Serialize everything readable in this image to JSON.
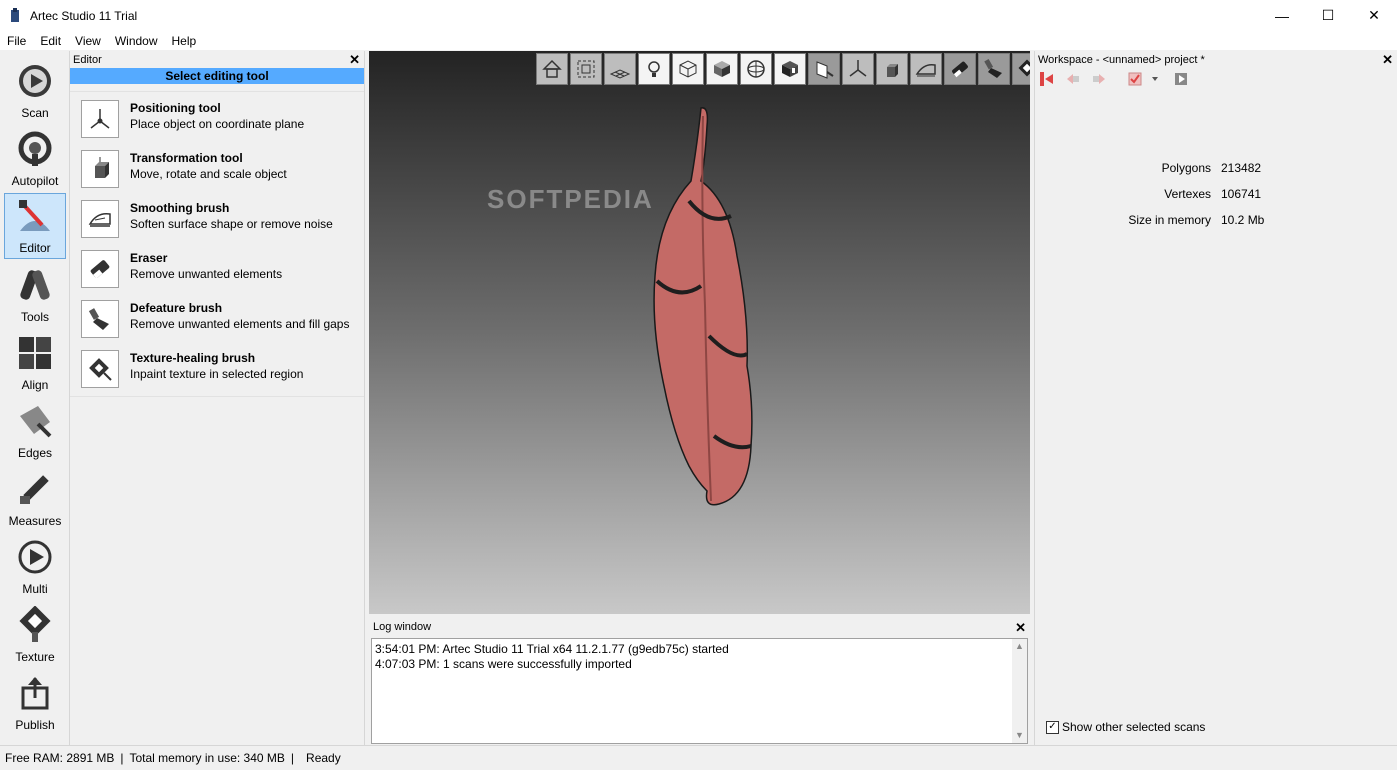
{
  "window": {
    "title": "Artec Studio 11 Trial",
    "minimize": "—",
    "maximize": "☐",
    "close": "✕"
  },
  "menu": [
    "File",
    "Edit",
    "View",
    "Window",
    "Help"
  ],
  "nav": [
    {
      "label": "Scan",
      "icon": "scan-icon"
    },
    {
      "label": "Autopilot",
      "icon": "autopilot-icon"
    },
    {
      "label": "Editor",
      "icon": "editor-icon",
      "active": true
    },
    {
      "label": "Tools",
      "icon": "tools-icon"
    },
    {
      "label": "Align",
      "icon": "align-icon"
    },
    {
      "label": "Edges",
      "icon": "edges-icon"
    },
    {
      "label": "Measures",
      "icon": "measures-icon"
    },
    {
      "label": "Multi",
      "icon": "multi-icon"
    },
    {
      "label": "Texture",
      "icon": "texture-icon"
    },
    {
      "label": "Publish",
      "icon": "publish-icon"
    }
  ],
  "editor": {
    "title": "Editor",
    "close": "✕",
    "select_label": "Select editing tool",
    "tools": [
      {
        "name": "Positioning tool",
        "desc": "Place object on coordinate plane",
        "icon": "positioning-icon"
      },
      {
        "name": "Transformation tool",
        "desc": "Move, rotate and scale object",
        "icon": "transformation-icon"
      },
      {
        "name": "Smoothing brush",
        "desc": "Soften surface shape or remove noise",
        "icon": "smoothing-icon"
      },
      {
        "name": "Eraser",
        "desc": "Remove unwanted elements",
        "icon": "eraser-icon"
      },
      {
        "name": "Defeature brush",
        "desc": "Remove unwanted elements and fill gaps",
        "icon": "defeature-icon"
      },
      {
        "name": "Texture-healing brush",
        "desc": "Inpaint texture in selected region",
        "icon": "texture-healing-icon"
      }
    ]
  },
  "viewport": {
    "watermark": "SOFTPEDIA",
    "model_color": "#c46a66",
    "toolbar": [
      "home-view-icon",
      "fit-view-icon",
      "grid-icon",
      "light-icon",
      "wireframe-icon",
      "solid-icon",
      "sphere-icon",
      "texture-cube-icon",
      "section-icon",
      "positioning-icon",
      "transform-icon",
      "smoothing-icon",
      "eraser-icon",
      "defeature-icon",
      "texture-heal-icon"
    ]
  },
  "log": {
    "title": "Log window",
    "close": "✕",
    "lines": [
      "3:54:01 PM: Artec Studio 11 Trial x64 11.2.1.77 (g9edb75c) started",
      "4:07:03 PM: 1 scans were successfully imported"
    ]
  },
  "workspace": {
    "title": "Workspace - <unnamed> project *",
    "close": "✕",
    "stats": [
      {
        "label": "Polygons",
        "value": "213482"
      },
      {
        "label": "Vertexes",
        "value": "106741"
      },
      {
        "label": "Size in memory",
        "value": "10.2 Mb"
      }
    ],
    "show_other_label": "Show other selected scans",
    "show_other_checked": true
  },
  "status": {
    "free_ram": "Free RAM: 2891 MB",
    "total_memory": "Total memory in use: 340 MB",
    "sep1": "|",
    "sep2": "|",
    "state": "Ready"
  }
}
